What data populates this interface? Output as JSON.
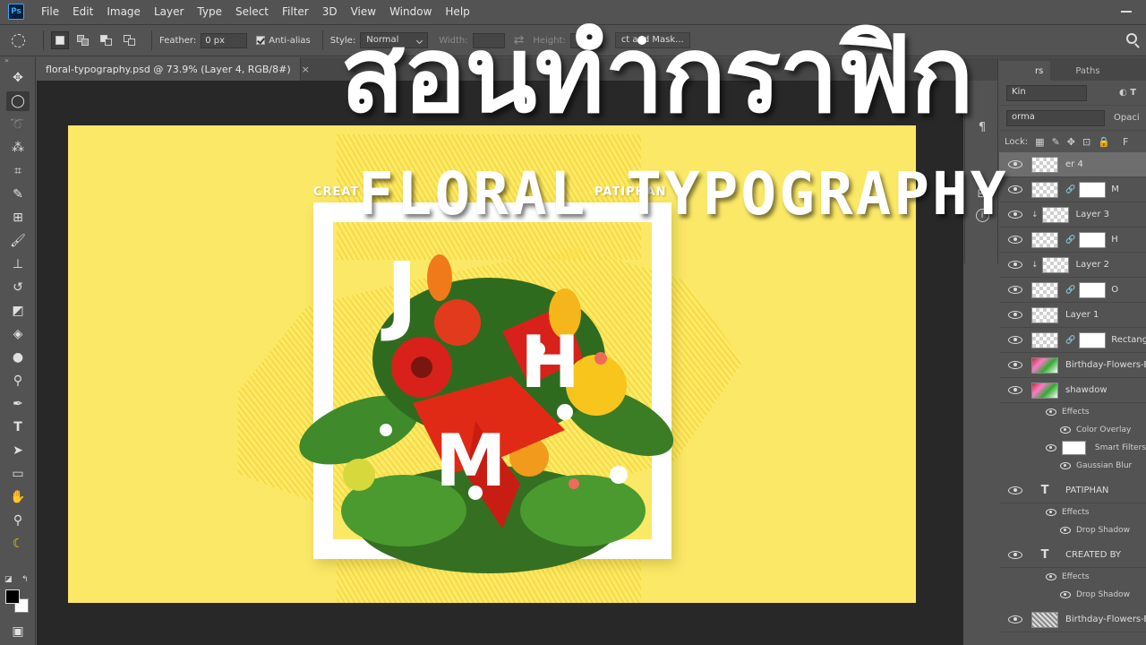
{
  "app": {
    "logo": "Ps",
    "menu": [
      "File",
      "Edit",
      "Image",
      "Layer",
      "Type",
      "Select",
      "Filter",
      "3D",
      "View",
      "Window",
      "Help"
    ]
  },
  "options": {
    "feather_label": "Feather:",
    "feather_value": "0 px",
    "antialias_label": "Anti-alias",
    "style_label": "Style:",
    "style_value": "Normal",
    "width_label": "Width:",
    "height_label": "Height:",
    "mask_button": "ct and Mask..."
  },
  "document": {
    "tab_title": "floral-typography.psd @ 73.9% (Layer 4, RGB/8#)",
    "close": "×"
  },
  "overlay": {
    "thai_title": "สอนทำกราฟิก",
    "english_title": "FLORAL TYPOGRAPHY"
  },
  "artwork": {
    "credit_left": "CREAT",
    "credit_right": "PATIPHAN",
    "letters": [
      "J",
      "H",
      "M"
    ],
    "colors": {
      "background": "#fbe866",
      "frame": "#ffffff",
      "petal_red": "#d8211b",
      "petal_yellow": "#f8c51c",
      "leaf": "#3f8a2a"
    }
  },
  "panel": {
    "tab_layers": "rs",
    "tab_paths": "Paths",
    "kind": "Kin",
    "blend": "orma",
    "opacity": "Opaci",
    "lock_label": "Lock:",
    "fill_glyph": "F"
  },
  "layers": [
    {
      "name": "er 4",
      "kind": "pixel",
      "selected": true
    },
    {
      "name": "M",
      "kind": "masked"
    },
    {
      "name": "Layer 3",
      "kind": "clipped"
    },
    {
      "name": "H",
      "kind": "masked"
    },
    {
      "name": "Layer 2",
      "kind": "clipped"
    },
    {
      "name": "O",
      "kind": "masked"
    },
    {
      "name": "Layer 1",
      "kind": "pixel"
    },
    {
      "name": "Rectangle",
      "kind": "shape"
    },
    {
      "name": "Birthday-Flowers-Bo",
      "kind": "photo"
    },
    {
      "name": "shawdow",
      "kind": "smart"
    },
    {
      "name": "Effects",
      "kind": "effects"
    },
    {
      "name": "Color Overlay",
      "kind": "effect"
    },
    {
      "name": "Smart Filters",
      "kind": "smartfilters"
    },
    {
      "name": "Gaussian Blur",
      "kind": "effect"
    },
    {
      "name": "PATIPHAN",
      "kind": "type"
    },
    {
      "name": "Effects",
      "kind": "effects"
    },
    {
      "name": "Drop Shadow",
      "kind": "effect"
    },
    {
      "name": "CREATED BY",
      "kind": "type"
    },
    {
      "name": "Effects",
      "kind": "effects"
    },
    {
      "name": "Drop Shadow",
      "kind": "effect"
    },
    {
      "name": "Birthday-Flowers-Bo",
      "kind": "photo"
    }
  ]
}
